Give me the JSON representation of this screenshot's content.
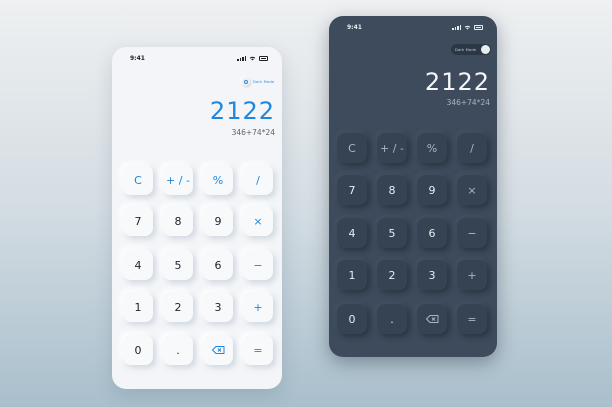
{
  "light": {
    "time": "9:41",
    "toggle_label": "Dark Mode",
    "result": "2122",
    "expression": "346+74*24",
    "keys": {
      "clear": "C",
      "sign": "+ / -",
      "percent": "%",
      "divide": "/",
      "k7": "7",
      "k8": "8",
      "k9": "9",
      "multiply": "×",
      "k4": "4",
      "k5": "5",
      "k6": "6",
      "minus": "−",
      "k1": "1",
      "k2": "2",
      "k3": "3",
      "plus": "+",
      "k0": "0",
      "dot": ".",
      "equals": "="
    }
  },
  "dark": {
    "time": "9:41",
    "toggle_label": "Dark Mode",
    "result": "2122",
    "expression": "346+74*24",
    "keys": {
      "clear": "C",
      "sign": "+ / -",
      "percent": "%",
      "divide": "/",
      "k7": "7",
      "k8": "8",
      "k9": "9",
      "multiply": "×",
      "k4": "4",
      "k5": "5",
      "k6": "6",
      "minus": "−",
      "k1": "1",
      "k2": "2",
      "k3": "3",
      "plus": "+",
      "k0": "0",
      "dot": ".",
      "equals": "="
    }
  },
  "colors": {
    "accent_blue": "#1f86dc",
    "dark_bg": "#3d4b5c",
    "light_bg": "#f3f5f8"
  },
  "icons": [
    "signal-icon",
    "wifi-icon",
    "battery-icon",
    "backspace-icon",
    "toggle-knob-icon"
  ]
}
